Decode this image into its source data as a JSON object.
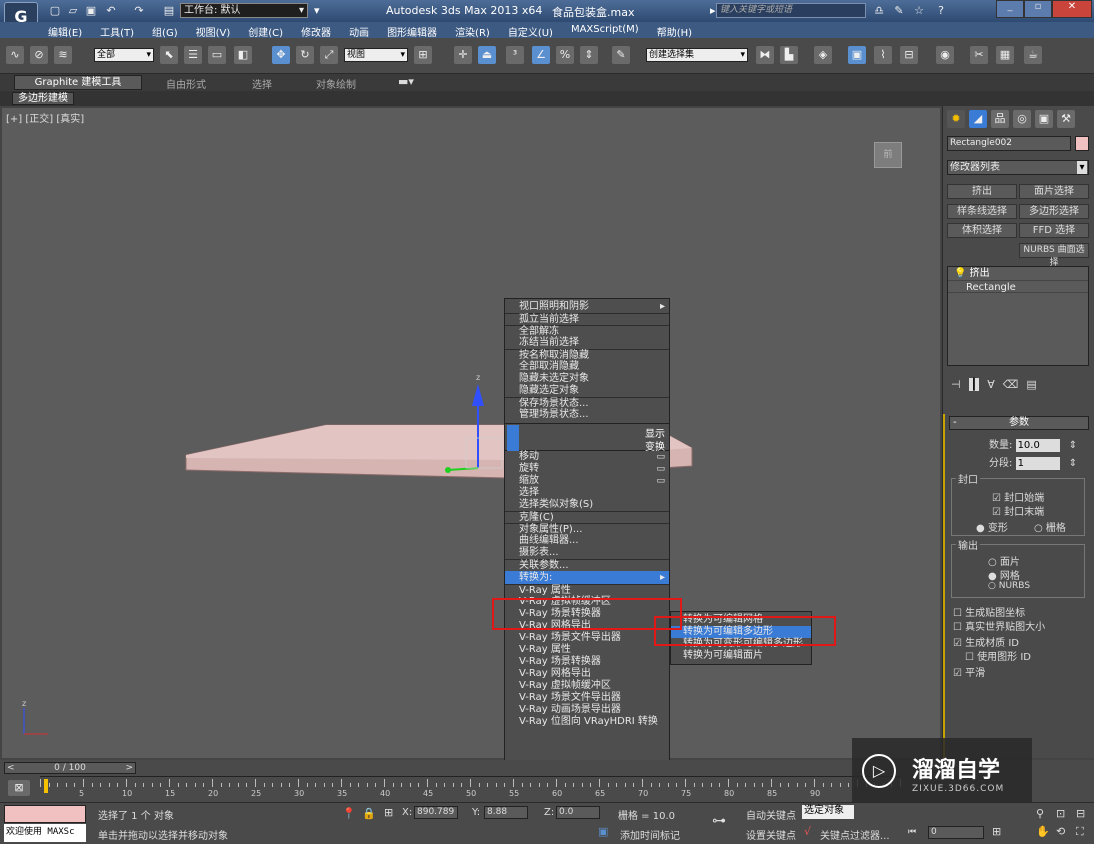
{
  "titlebar": {
    "workspace_label": "工作台: 默认",
    "app_title": "Autodesk 3ds Max  2013 x64",
    "file_name": "食品包装盒.max",
    "search_placeholder": "键入关键字或短语"
  },
  "menubar": {
    "items": [
      "编辑(E)",
      "工具(T)",
      "组(G)",
      "视图(V)",
      "创建(C)",
      "修改器",
      "动画",
      "图形编辑器",
      "渲染(R)",
      "自定义(U)",
      "MAXScript(M)",
      "帮助(H)"
    ]
  },
  "toolbar": {
    "filter_value": "全部",
    "coord_value": "视图",
    "selection_set_value": "创建选择集"
  },
  "ribbon": {
    "tabs": [
      "Graphite 建模工具",
      "自由形式",
      "选择",
      "对象绘制"
    ],
    "sub_tab": "多边形建模"
  },
  "viewport": {
    "label": "[+] [正交] [真实]",
    "viewcube_label": "前"
  },
  "quad_menu": {
    "display_items": [
      "视口照明和阴影",
      "孤立当前选择",
      "全部解冻",
      "冻结当前选择",
      "按名称取消隐藏",
      "全部取消隐藏",
      "隐藏未选定对象",
      "隐藏选定对象",
      "保存场景状态...",
      "管理场景状态..."
    ],
    "display_label": "显示",
    "transform_label": "变换",
    "transform_items": [
      "移动",
      "旋转",
      "缩放",
      "选择",
      "选择类似对象(S)",
      "克隆(C)",
      "对象属性(P)...",
      "曲线编辑器...",
      "摄影表...",
      "关联参数..."
    ],
    "convert_label": "转换为:",
    "vray_items": [
      "V-Ray 属性",
      "V-Ray 虚拟帧缓冲区",
      "V-Ray 场景转换器",
      "V-Ray 网格导出",
      "V-Ray 场景文件导出器",
      "V-Ray 属性",
      "V-Ray 场景转换器",
      "V-Ray 网格导出",
      "V-Ray 虚拟帧缓冲区",
      "V-Ray 场景文件导出器",
      "V-Ray 动画场景导出器",
      "V-Ray 位图向 VRayHDRI 转换"
    ]
  },
  "submenu": {
    "items": [
      "转换为可编辑网格",
      "转换为可编辑多边形",
      "转换为可变形可编辑多边形",
      "转换为可编辑面片"
    ],
    "highlighted_index": 1
  },
  "command_panel": {
    "object_name": "Rectangle002",
    "modifier_list": "修改器列表",
    "mod_buttons": [
      "挤出",
      "面片选择",
      "样条线选择",
      "多边形选择",
      "体积选择",
      "FFD 选择",
      "NURBS 曲面选择"
    ],
    "stack_items": [
      "挤出",
      "Rectangle"
    ],
    "params_title": "参数",
    "amount_label": "数量:",
    "amount_value": "10.0",
    "segments_label": "分段:",
    "segments_value": "1",
    "capping_title": "封口",
    "cap_start": "封口始端",
    "cap_end": "封口末端",
    "morph": "变形",
    "grid": "栅格",
    "output_title": "输出",
    "output_options": [
      "面片",
      "网格",
      "NURBS"
    ],
    "gen_map_coords": "生成贴图坐标",
    "real_world": "真实世界贴图大小",
    "gen_mat_ids": "生成材质 ID",
    "use_shape_ids": "使用图形 ID",
    "smooth": "平滑"
  },
  "timeline": {
    "frame_counter": "0 / 100",
    "ticks": [
      "5",
      "10",
      "15",
      "20",
      "25",
      "30",
      "35",
      "40",
      "45",
      "50",
      "55",
      "60",
      "65",
      "70",
      "75",
      "80",
      "85",
      "90"
    ]
  },
  "status": {
    "welcome": "欢迎使用 MAXSc",
    "selected_text": "选择了 1 个 对象",
    "prompt_text": "单击并拖动以选择并移动对象",
    "x_label": "X:",
    "x_value": "890.789",
    "y_label": "Y:",
    "y_value": "8.88",
    "z_label": "Z:",
    "z_value": "0.0",
    "grid_text": "栅格 = 10.0",
    "add_time_tag": "添加时间标记",
    "auto_key": "自动关键点",
    "selected_obj": "选定对象",
    "set_key": "设置关键点",
    "key_filters": "关键点过滤器...",
    "frame_value": "0"
  },
  "watermark": {
    "brand": "溜溜自学",
    "url": "ZIXUE.3D66.COM"
  }
}
